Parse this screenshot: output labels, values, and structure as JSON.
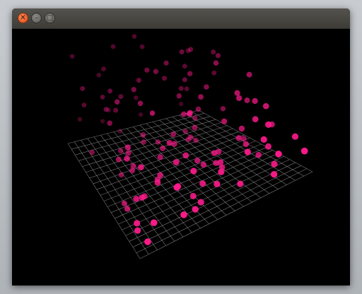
{
  "window": {
    "title": "",
    "controls": {
      "close_glyph": "✕",
      "minimize_glyph": "–",
      "maximize_glyph": "□"
    }
  },
  "scene": {
    "background_color": "#000000",
    "grid_color": "#8a8a8a",
    "point_color": "#ff1a8c",
    "grid_divisions": 20
  }
}
